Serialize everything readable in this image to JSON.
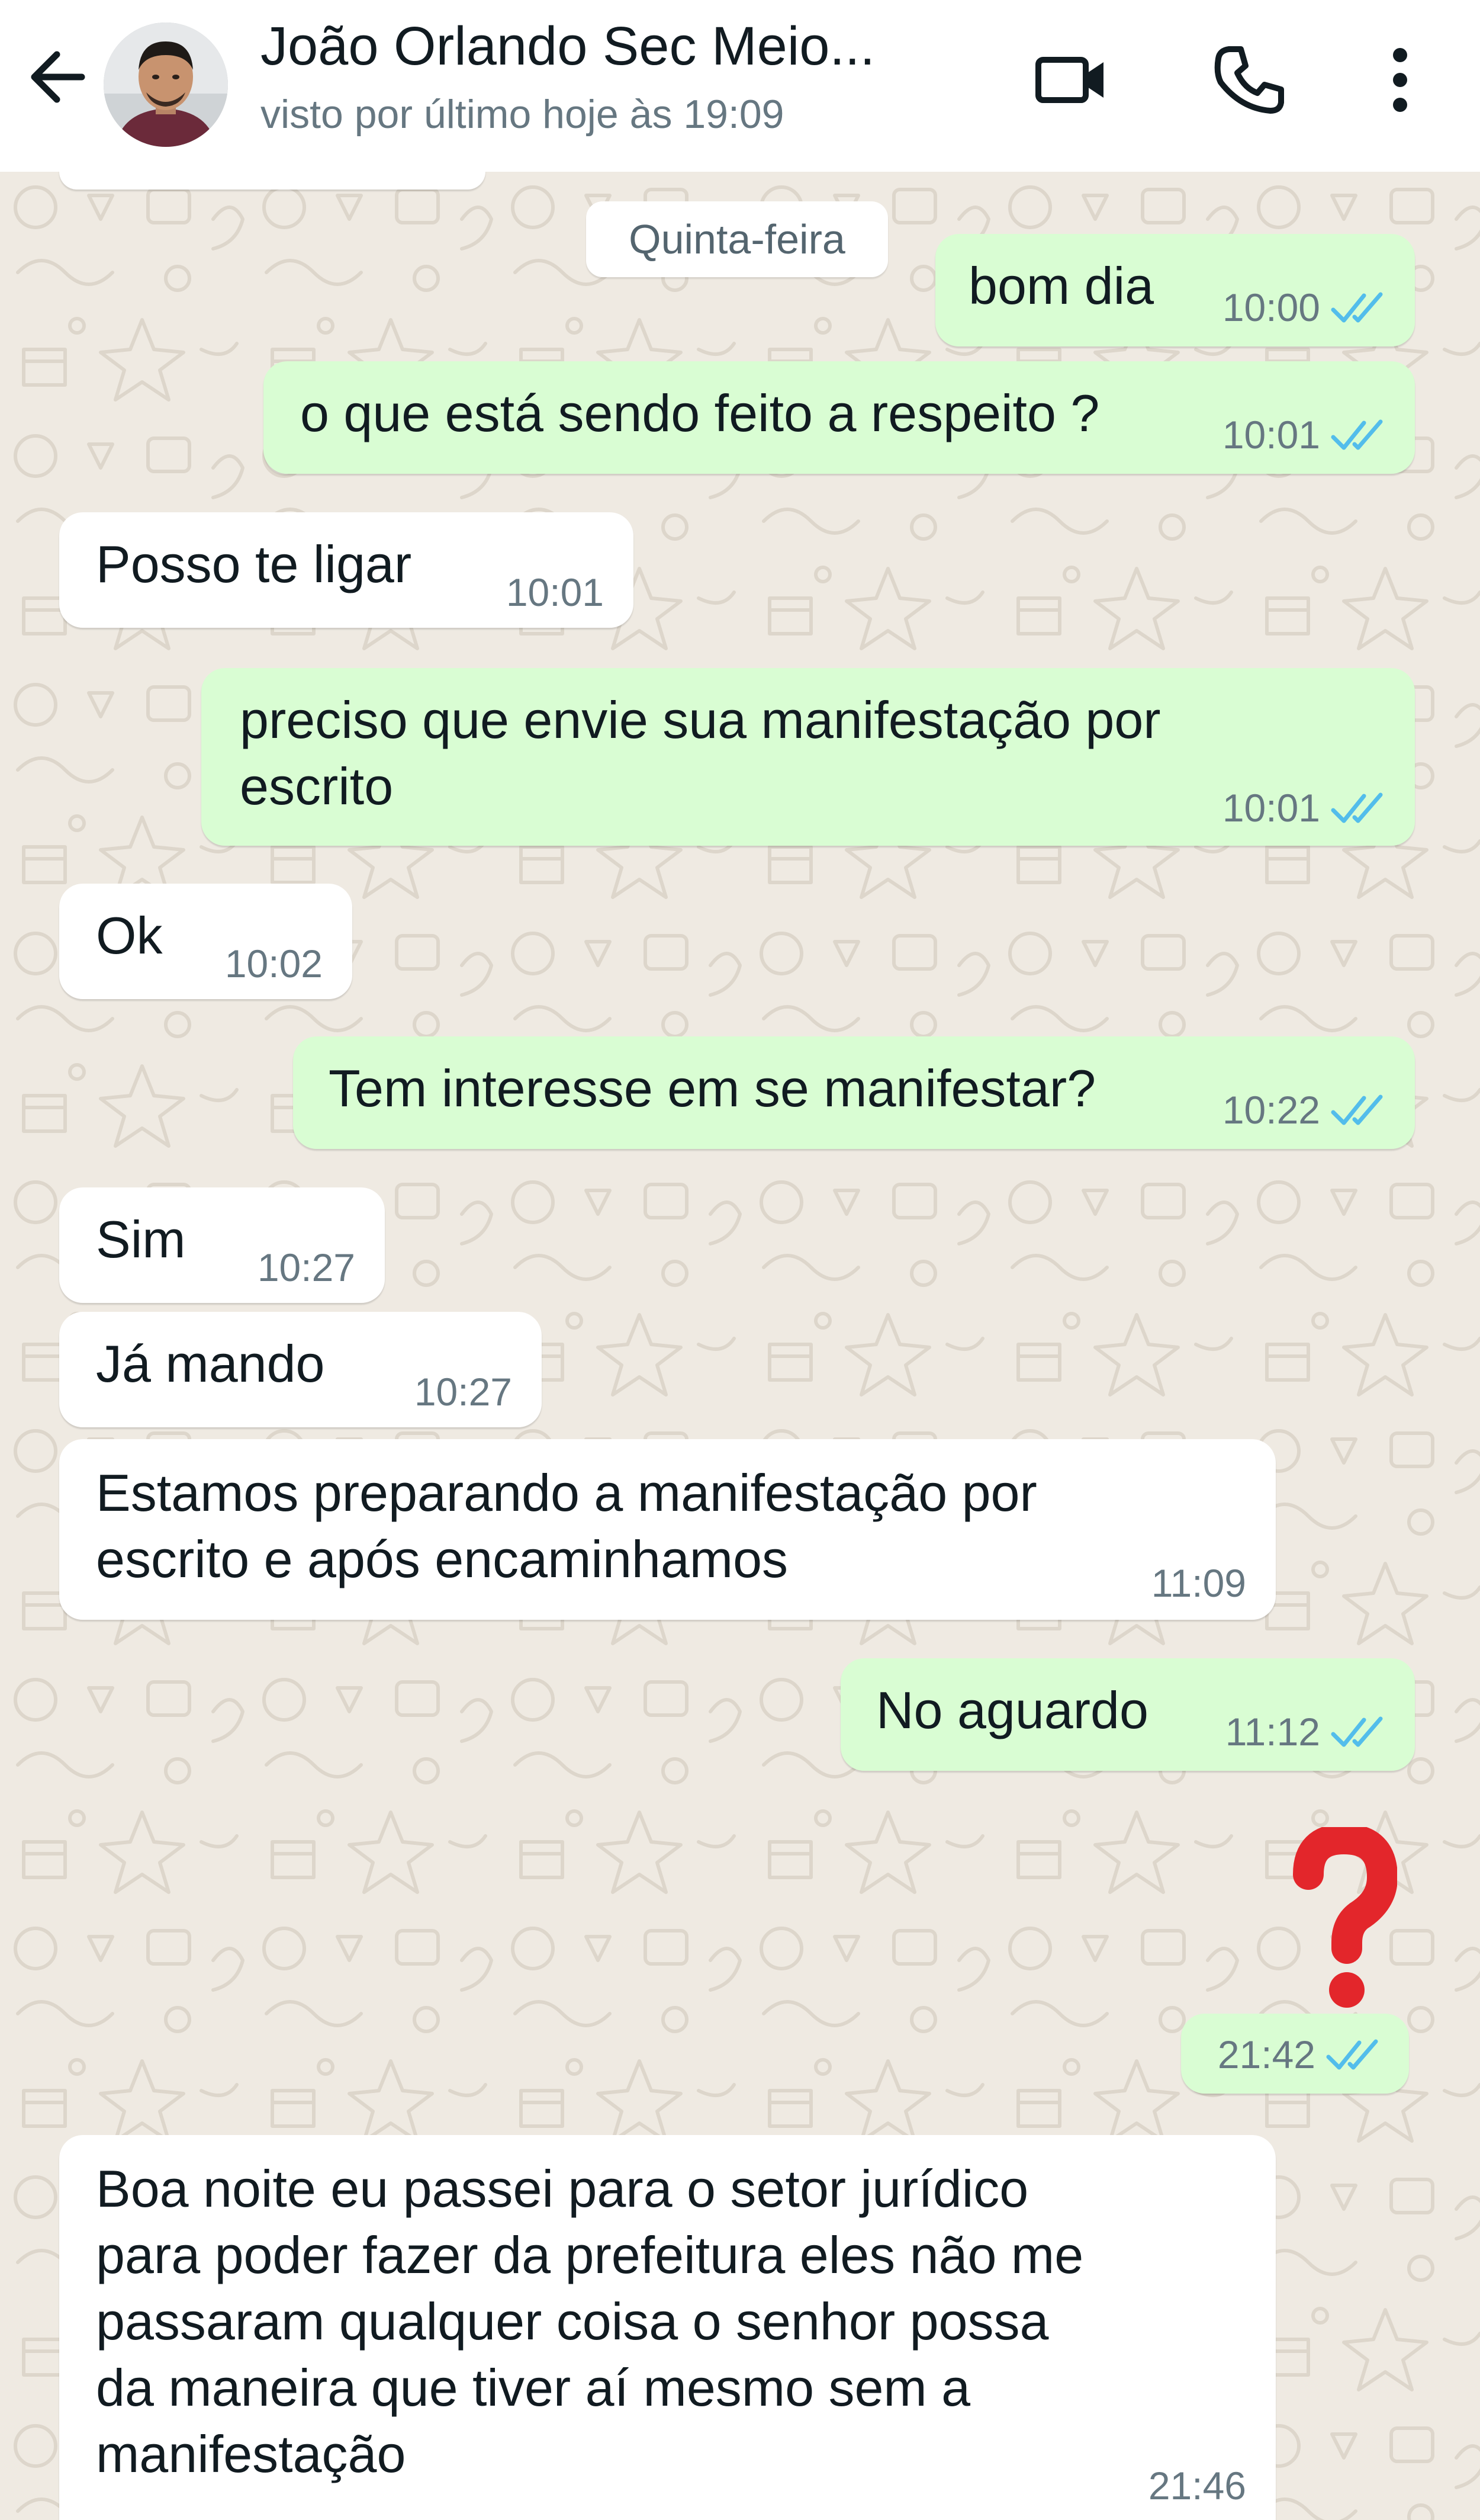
{
  "header": {
    "contact_name": "João Orlando Sec Meio...",
    "status": "visto por último hoje às 19:09",
    "icons": {
      "back": "arrow-left-icon",
      "video": "video-call-icon",
      "call": "phone-icon",
      "menu": "more-vertical-icon"
    }
  },
  "chat": {
    "date_chip": "Quinta-feira",
    "colors": {
      "outgoing_bubble": "#d9fdd3",
      "incoming_bubble": "#ffffff",
      "read_ticks": "#53bdeb",
      "wallpaper": "#efeae2",
      "question_mark": "#e3262b"
    },
    "messages": [
      {
        "dir": "out",
        "text": "bom dia",
        "time": "10:00",
        "read": true
      },
      {
        "dir": "out",
        "text": "o que está sendo feito a respeito ?",
        "time": "10:01",
        "read": true
      },
      {
        "dir": "in",
        "text": "Posso te ligar",
        "time": "10:01"
      },
      {
        "dir": "out",
        "text": "preciso que envie sua manifestação por",
        "text2": "escrito",
        "time": "10:01",
        "read": true
      },
      {
        "dir": "in",
        "text": "Ok",
        "time": "10:02"
      },
      {
        "dir": "out",
        "text": "Tem interesse em se manifestar?",
        "time": "10:22",
        "read": true
      },
      {
        "dir": "in",
        "text": "Sim",
        "time": "10:27"
      },
      {
        "dir": "in",
        "text": "Já mando",
        "time": "10:27"
      },
      {
        "dir": "in",
        "text": "Estamos preparando a manifestação por",
        "text2": "escrito e após encaminhamos",
        "time": "11:09"
      },
      {
        "dir": "out",
        "text": "No aguardo",
        "time": "11:12",
        "read": true
      },
      {
        "dir": "out",
        "sticker": "red-question-mark-emoji",
        "time": "21:42",
        "read": true
      },
      {
        "dir": "in",
        "lines": [
          "Boa noite eu passei para o setor jurídico",
          "para poder fazer da prefeitura eles não me",
          "passaram qualquer coisa o senhor possa",
          "da maneira que tiver aí mesmo sem a",
          "manifestação"
        ],
        "time": "21:46"
      }
    ]
  }
}
